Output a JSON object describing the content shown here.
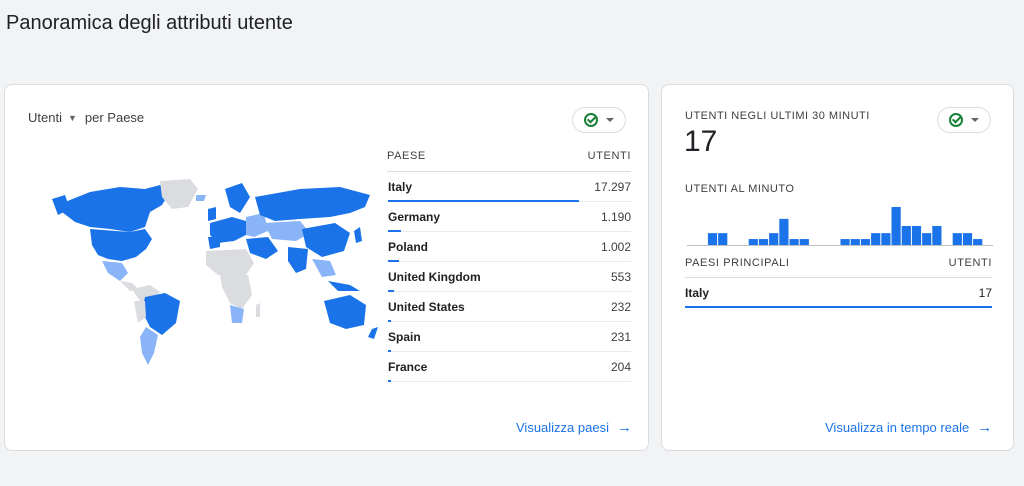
{
  "page": {
    "title": "Panoramica degli attributi utente"
  },
  "colors": {
    "primary": "#1a73e8",
    "light": "#8ab4f8",
    "nodata": "#dadce0",
    "ok": "#188038"
  },
  "left_card": {
    "metric_label": "Utenti",
    "dimension_label": "per Paese",
    "table": {
      "col_country": "PAESE",
      "col_users": "UTENTI",
      "rows": [
        {
          "country": "Italy",
          "users": "17.297",
          "value": 17297
        },
        {
          "country": "Germany",
          "users": "1.190",
          "value": 1190
        },
        {
          "country": "Poland",
          "users": "1.002",
          "value": 1002
        },
        {
          "country": "United Kingdom",
          "users": "553",
          "value": 553
        },
        {
          "country": "United States",
          "users": "232",
          "value": 232
        },
        {
          "country": "Spain",
          "users": "231",
          "value": 231
        },
        {
          "country": "France",
          "users": "204",
          "value": 204
        }
      ]
    },
    "link": "Visualizza paesi"
  },
  "right_card": {
    "title": "UTENTI NEGLI ULTIMI 30 MINUTI",
    "value": "17",
    "per_minute_label": "UTENTI AL MINUTO",
    "per_minute_values": [
      0,
      0,
      1,
      1,
      0,
      0,
      0.5,
      0.5,
      1,
      2.2,
      0.5,
      0.5,
      0,
      0,
      0,
      0.5,
      0.5,
      0.5,
      1,
      1,
      3.2,
      1.6,
      1.6,
      1,
      1.6,
      0,
      1,
      1,
      0.5,
      0
    ],
    "table": {
      "col_country": "PAESI PRINCIPALI",
      "col_users": "UTENTI",
      "rows": [
        {
          "country": "Italy",
          "users": "17",
          "value": 17
        }
      ]
    },
    "link": "Visualizza in tempo reale"
  }
}
